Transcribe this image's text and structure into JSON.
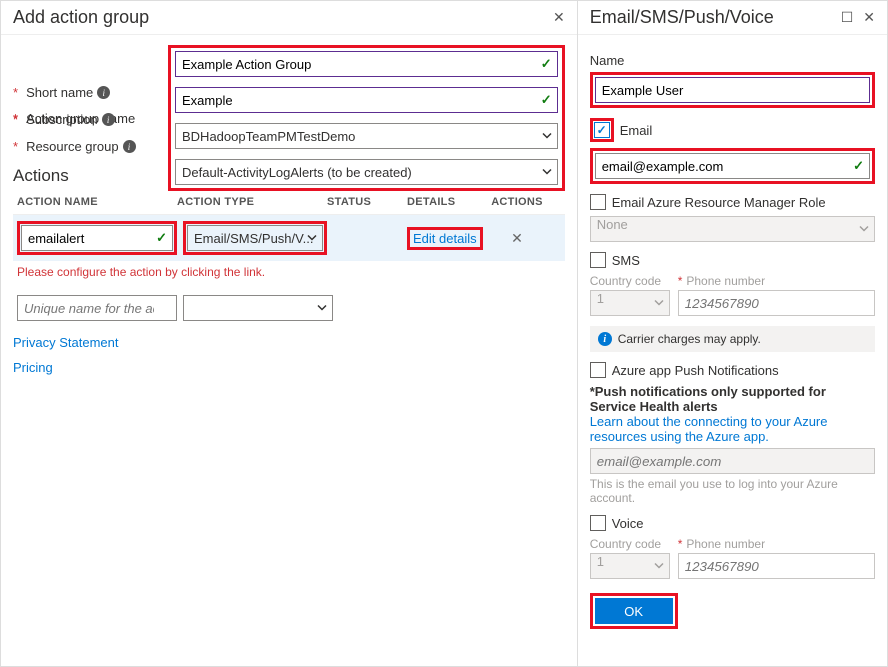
{
  "left": {
    "title": "Add action group",
    "labels": {
      "action_group_name": "Action group name",
      "short_name": "Short name",
      "subscription": "Subscription",
      "resource_group": "Resource group"
    },
    "values": {
      "action_group_name": "Example Action Group",
      "short_name": "Example",
      "subscription": "BDHadoopTeamPMTestDemo",
      "resource_group": "Default-ActivityLogAlerts (to be created)"
    },
    "actions_header": "Actions",
    "columns": {
      "name": "ACTION NAME",
      "type": "ACTION TYPE",
      "status": "STATUS",
      "details": "DETAILS",
      "actions": "ACTIONS"
    },
    "row1": {
      "name": "emailalert",
      "type": "Email/SMS/Push/V...",
      "details": "Edit details"
    },
    "error": "Please configure the action by clicking the link.",
    "new_row_placeholder": "Unique name for the act...",
    "links": {
      "privacy": "Privacy Statement",
      "pricing": "Pricing"
    }
  },
  "right": {
    "title": "Email/SMS/Push/Voice",
    "name_label": "Name",
    "name_value": "Example User",
    "email_label": "Email",
    "email_value": "email@example.com",
    "arm_role_label": "Email Azure Resource Manager Role",
    "arm_role_value": "None",
    "sms_label": "SMS",
    "country_code_label": "Country code",
    "phone_label": "Phone number",
    "country_code_value": "1",
    "phone_placeholder": "1234567890",
    "carrier_notice": "Carrier charges may apply.",
    "push_label": "Azure app Push Notifications",
    "push_note": "*Push notifications only supported for Service Health alerts",
    "push_link": "Learn about the connecting to your Azure resources using the Azure app.",
    "push_placeholder": "email@example.com",
    "push_help": "This is the email you use to log into your Azure account.",
    "voice_label": "Voice",
    "ok": "OK"
  }
}
